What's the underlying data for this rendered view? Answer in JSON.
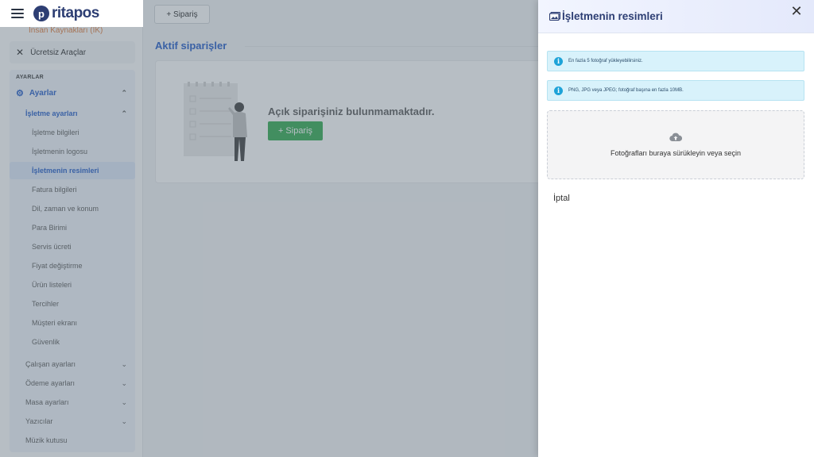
{
  "app": {
    "logo_text": "ritapos",
    "logo_mark": "p"
  },
  "sidebar": {
    "hr_item": "İnsan Kaynakları (İK)",
    "tools_item": "Ücretsiz Araçlar",
    "section_label": "AYARLAR",
    "settings_label": "Ayarlar",
    "business_settings_label": "İşletme ayarları",
    "business_sub_items": [
      "İşletme bilgileri",
      "İşletmenin logosu",
      "İşletmenin resimleri",
      "Fatura bilgileri",
      "Dil, zaman ve konum",
      "Para Birimi",
      "Servis ücreti",
      "Fiyat değiştirme",
      "Ürün listeleri",
      "Tercihler",
      "Müşteri ekranı",
      "Güvenlik"
    ],
    "active_item": "İşletmenin resimleri",
    "groups": [
      "Çalışan ayarları",
      "Ödeme ayarları",
      "Masa ayarları",
      "Yazıcılar"
    ],
    "last_item": "Müzik kutusu"
  },
  "main": {
    "add_order_button": "+ Sipariş",
    "section_title": "Aktif siparişler",
    "empty_message": "Açık siparişiniz bulunmamaktadır.",
    "empty_add_button": "+ Sipariş"
  },
  "drawer": {
    "title": "İşletmenin resimleri",
    "info_messages": [
      "En fazla 5 fotoğraf yükleyebilirsiniz.",
      "PNG, JPG veya JPEG; fotoğraf başına en fazla 10MB."
    ],
    "dropzone_text": "Fotoğrafları buraya sürükleyin veya seçin",
    "cancel_label": "İptal"
  },
  "colors": {
    "brand": "#2d3e73",
    "accent_blue": "#1c57c7",
    "green_button": "#2aa84a",
    "info_background": "#d8f2fb"
  },
  "icons": [
    "menu-icon",
    "tools-icon",
    "gear-icon",
    "chevron-up-icon",
    "chevron-down-icon",
    "image-icon",
    "close-icon",
    "info-icon",
    "cloud-upload-icon"
  ]
}
